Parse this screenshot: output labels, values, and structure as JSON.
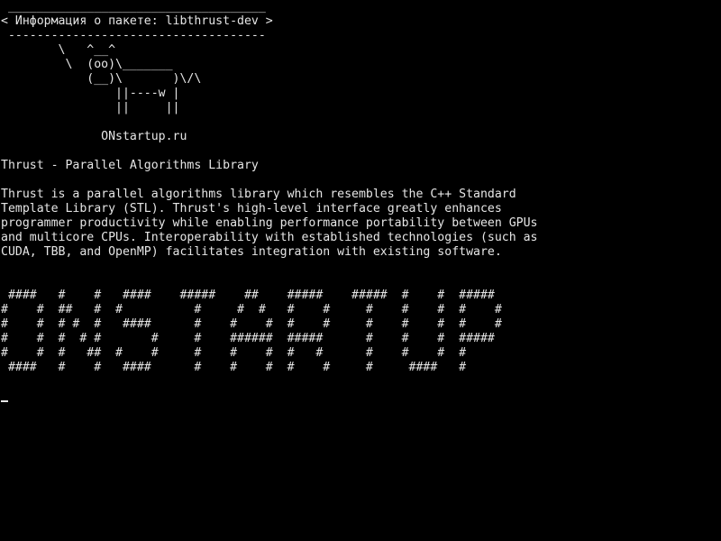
{
  "colors": {
    "background": "#000000",
    "foreground": "#e6e6e6"
  },
  "cowsay": {
    "top_border": " ____________________________________",
    "message": "< Информация о пакете: libthrust-dev >",
    "bottom_border": " ------------------------------------",
    "cow": [
      "        \\   ^__^",
      "         \\  (oo)\\_______",
      "            (__)\\       )\\/\\",
      "                ||----w |",
      "                ||     ||"
    ]
  },
  "site": "              ONstartup.ru",
  "package": {
    "title": "Thrust - Parallel Algorithms Library",
    "description": [
      "Thrust is a parallel algorithms library which resembles the C++ Standard",
      "Template Library (STL). Thrust's high-level interface greatly enhances",
      "programmer productivity while enabling performance portability between GPUs",
      "and multicore CPUs. Interoperability with established technologies (such as",
      "CUDA, TBB, and OpenMP) facilitates integration with existing software."
    ]
  },
  "banner": [
    " ####   #    #   ####    #####    ##    #####    #####  #    #  #####",
    "#    #  ##   #  #          #     #  #   #    #     #    #    #  #    #",
    "#    #  # #  #   ####      #    #    #  #    #     #    #    #  #    #",
    "#    #  #  # #       #     #    ######  #####      #    #    #  #####",
    "#    #  #   ##  #    #     #    #    #  #   #      #    #    #  #",
    " ####   #    #   ####      #    #    #  #    #     #     ####   #"
  ]
}
